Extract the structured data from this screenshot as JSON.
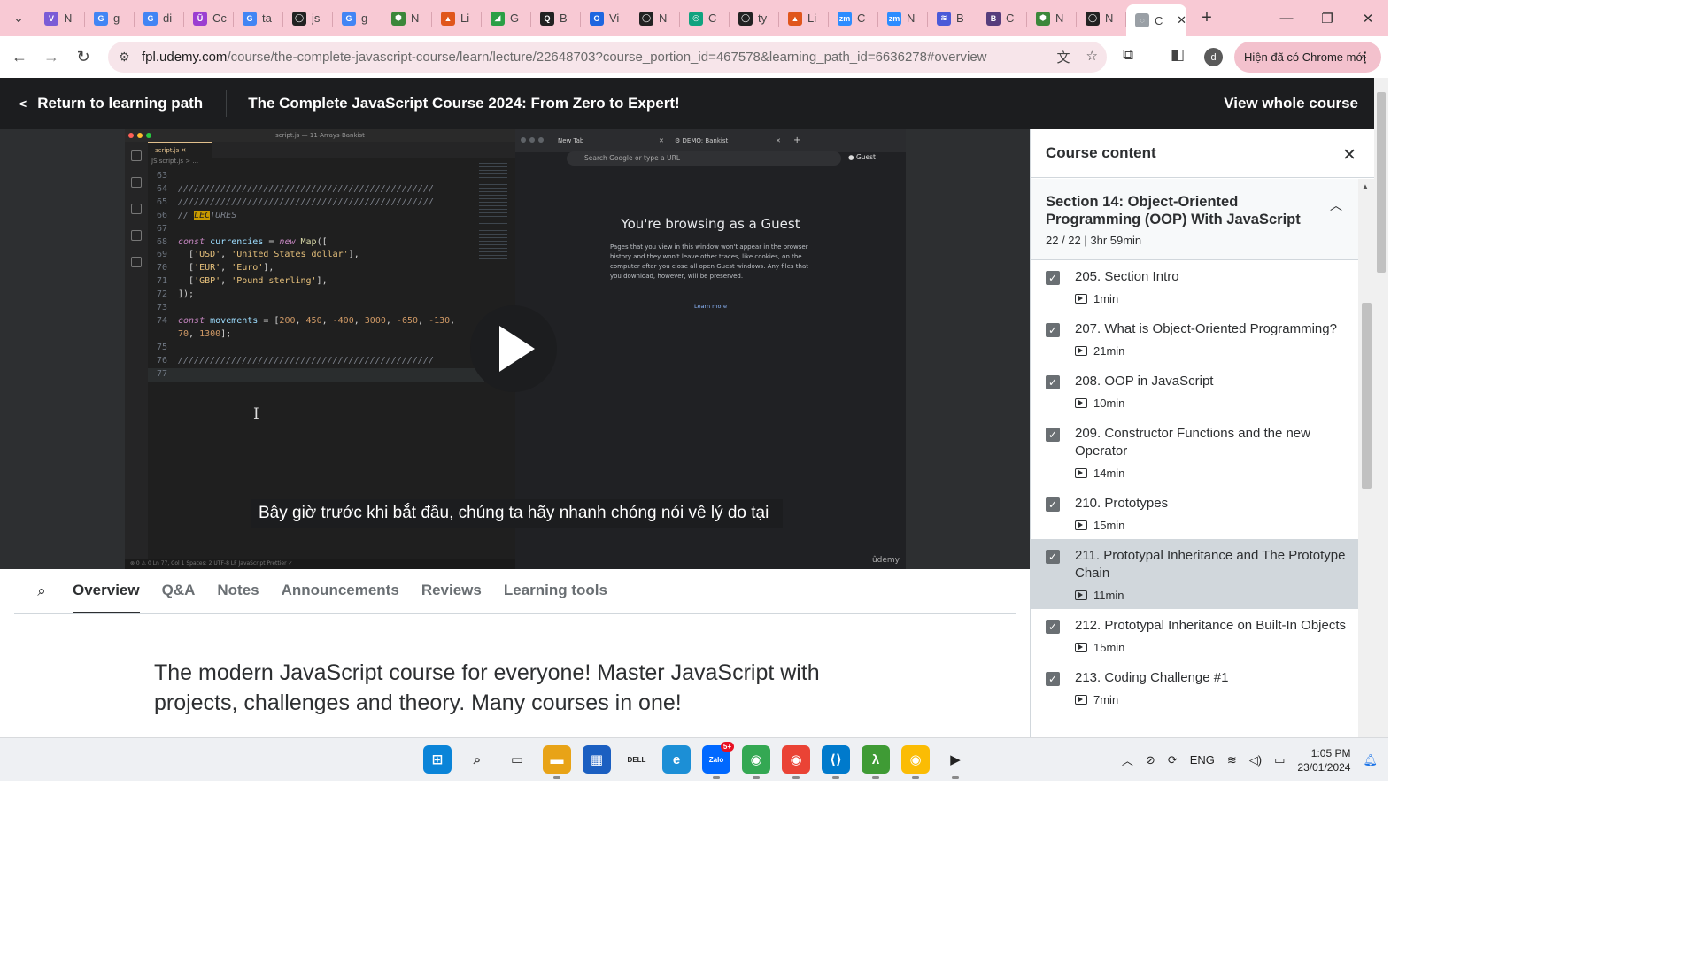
{
  "browser": {
    "tabs": [
      {
        "icon": "V",
        "title": "N",
        "color": "#7b5cd6"
      },
      {
        "icon": "G",
        "title": "g",
        "color": "#4285f4"
      },
      {
        "icon": "G",
        "title": "di",
        "color": "#4285f4"
      },
      {
        "icon": "Ũ",
        "title": "Cc",
        "color": "#9b3fd1"
      },
      {
        "icon": "G",
        "title": "ta",
        "color": "#4285f4"
      },
      {
        "icon": "◯",
        "title": "js",
        "color": "#222222"
      },
      {
        "icon": "G",
        "title": "g",
        "color": "#4285f4"
      },
      {
        "icon": "⬢",
        "title": "N",
        "color": "#3c873a"
      },
      {
        "icon": "▲",
        "title": "Li",
        "color": "#e0561c"
      },
      {
        "icon": "◢",
        "title": "G",
        "color": "#2b9f45"
      },
      {
        "icon": "Q",
        "title": "B",
        "color": "#222222"
      },
      {
        "icon": "O",
        "title": "Vi",
        "color": "#1e66e0"
      },
      {
        "icon": "◯",
        "title": "N",
        "color": "#222222"
      },
      {
        "icon": "◎",
        "title": "C",
        "color": "#10a37f"
      },
      {
        "icon": "◯",
        "title": "ty",
        "color": "#222222"
      },
      {
        "icon": "▲",
        "title": "Li",
        "color": "#e0561c"
      },
      {
        "icon": "zm",
        "title": "C",
        "color": "#2d8cff"
      },
      {
        "icon": "zm",
        "title": "N",
        "color": "#2d8cff"
      },
      {
        "icon": "≋",
        "title": "B",
        "color": "#4a5ad8"
      },
      {
        "icon": "B",
        "title": "C",
        "color": "#563d7c"
      },
      {
        "icon": "⬢",
        "title": "N",
        "color": "#3c873a"
      },
      {
        "icon": "◯",
        "title": "N",
        "color": "#222222"
      }
    ],
    "active_tab_title": "C",
    "url_domain": "fpl.udemy.com",
    "url_path": "/course/the-complete-javascript-course/learn/lecture/22648703?course_portion_id=467578&learning_path_id=6636278#overview",
    "profile_initial": "d",
    "update_label": "Hiện đã có Chrome mới"
  },
  "header": {
    "back_label": "Return to learning path",
    "course_title": "The Complete JavaScript Course 2024: From Zero to Expert!",
    "view_whole_label": "View whole course"
  },
  "video": {
    "vscode_title": "script.js — 11-Arrays-Bankist",
    "vscode_tab": "script.js",
    "vscode_crumb": "JS script.js > ...",
    "code_lines": [
      {
        "ln": "63",
        "html": ""
      },
      {
        "ln": "64",
        "html": "<span class=\"c\">////////////////////////////////////////////////</span>"
      },
      {
        "ln": "65",
        "html": "<span class=\"c\">////////////////////////////////////////////////</span>"
      },
      {
        "ln": "66",
        "html": "<span class=\"c\">// <span class=\"hl\">LEC</span>TURES</span>"
      },
      {
        "ln": "67",
        "html": ""
      },
      {
        "ln": "68",
        "html": "<span class=\"k\">const</span> <span class=\"v\">currencies</span> = <span class=\"k\">new</span> <span class=\"f\">Map</span>(["
      },
      {
        "ln": "69",
        "html": "  [<span class=\"s\">'USD'</span>, <span class=\"s\">'United States dollar'</span>],"
      },
      {
        "ln": "70",
        "html": "  [<span class=\"s\">'EUR'</span>, <span class=\"s\">'Euro'</span>],"
      },
      {
        "ln": "71",
        "html": "  [<span class=\"s\">'GBP'</span>, <span class=\"s\">'Pound sterling'</span>],"
      },
      {
        "ln": "72",
        "html": "]);"
      },
      {
        "ln": "73",
        "html": ""
      },
      {
        "ln": "74",
        "html": "<span class=\"k\">const</span> <span class=\"v\">movements</span> = [<span class=\"n\">200</span>, <span class=\"n\">450</span>, <span class=\"n\">-400</span>, <span class=\"n\">3000</span>, <span class=\"n\">-650</span>, <span class=\"n\">-130</span>,"
      },
      {
        "ln": "",
        "html": "<span class=\"n\">70</span>, <span class=\"n\">1300</span>];"
      },
      {
        "ln": "75",
        "html": ""
      },
      {
        "ln": "76",
        "html": "<span class=\"c\">////////////////////////////////////////////////</span>"
      },
      {
        "ln": "77",
        "html": ""
      }
    ],
    "vscode_status": "⊗ 0 ⚠ 0                                  Ln 77, Col 1   Spaces: 2   UTF-8   LF   JavaScript   Prettier ✓",
    "guest_tab1": "New Tab",
    "guest_tab2": "DEMO: Bankist",
    "guest_omni": "Search Google or type a URL",
    "guest_badge": "Guest",
    "guest_title": "You're browsing as a Guest",
    "guest_body": "Pages that you view in this window won't appear in the browser history and they won't leave other traces, like cookies, on the computer after you close all open Guest windows. Any files that you download, however, will be preserved.",
    "guest_learn": "Learn more",
    "watermark": "ûdemy",
    "caption": "Bây giờ trước khi bắt đầu, chúng ta hãy nhanh chóng nói về lý do tại"
  },
  "content_tabs": [
    {
      "label": "Overview",
      "active": true
    },
    {
      "label": "Q&A",
      "active": false
    },
    {
      "label": "Notes",
      "active": false
    },
    {
      "label": "Announcements",
      "active": false
    },
    {
      "label": "Reviews",
      "active": false
    },
    {
      "label": "Learning tools",
      "active": false
    }
  ],
  "overview": {
    "text": "The modern JavaScript course for everyone! Master JavaScript with projects, challenges and theory. Many courses in one!"
  },
  "sidebar": {
    "title": "Course content",
    "section_title": "Section 14: Object-Oriented Programming (OOP) With JavaScript",
    "section_meta": "22 / 22 | 3hr 59min",
    "lectures": [
      {
        "title": "205. Section Intro",
        "duration": "1min",
        "done": true,
        "current": false
      },
      {
        "title": "207. What is Object-Oriented Programming?",
        "duration": "21min",
        "done": true,
        "current": false
      },
      {
        "title": "208. OOP in JavaScript",
        "duration": "10min",
        "done": true,
        "current": false
      },
      {
        "title": "209. Constructor Functions and the new Operator",
        "duration": "14min",
        "done": true,
        "current": false
      },
      {
        "title": "210. Prototypes",
        "duration": "15min",
        "done": true,
        "current": false
      },
      {
        "title": "211. Prototypal Inheritance and The Prototype Chain",
        "duration": "11min",
        "done": true,
        "current": true
      },
      {
        "title": "212. Prototypal Inheritance on Built-In Objects",
        "duration": "15min",
        "done": true,
        "current": false
      },
      {
        "title": "213. Coding Challenge #1",
        "duration": "7min",
        "done": true,
        "current": false
      }
    ]
  },
  "taskbar": {
    "apps": [
      {
        "name": "windows-start",
        "glyph": "⊞",
        "color": "#0a84d8",
        "running": false,
        "badge": ""
      },
      {
        "name": "search",
        "glyph": "⌕",
        "color": "#444444",
        "running": false,
        "badge": ""
      },
      {
        "name": "task-view",
        "glyph": "▭",
        "color": "#333333",
        "running": false,
        "badge": ""
      },
      {
        "name": "file-explorer",
        "glyph": "▬",
        "color": "#e8a317",
        "running": true,
        "badge": ""
      },
      {
        "name": "store",
        "glyph": "▦",
        "color": "#1b5fc1",
        "running": false,
        "badge": ""
      },
      {
        "name": "dell",
        "glyph": "DELL",
        "color": "#222222",
        "running": false,
        "badge": ""
      },
      {
        "name": "edge",
        "glyph": "e",
        "color": "#1c8fd6",
        "running": false,
        "badge": ""
      },
      {
        "name": "zalo",
        "glyph": "Zalo",
        "color": "#0068ff",
        "running": true,
        "badge": "5+"
      },
      {
        "name": "chrome-profile-1",
        "glyph": "◉",
        "color": "#34a853",
        "running": true,
        "badge": ""
      },
      {
        "name": "chrome-profile-2",
        "glyph": "◉",
        "color": "#ea4335",
        "running": true,
        "badge": ""
      },
      {
        "name": "vscode",
        "glyph": "⟨⟩",
        "color": "#007acc",
        "running": true,
        "badge": ""
      },
      {
        "name": "app-green",
        "glyph": "λ",
        "color": "#3f9b35",
        "running": true,
        "badge": ""
      },
      {
        "name": "chrome-profile-3",
        "glyph": "◉",
        "color": "#fbbc04",
        "running": true,
        "badge": ""
      },
      {
        "name": "media-player",
        "glyph": "▶",
        "color": "#222222",
        "running": true,
        "badge": ""
      }
    ],
    "lang": "ENG",
    "time": "1:05 PM",
    "date": "23/01/2024"
  }
}
